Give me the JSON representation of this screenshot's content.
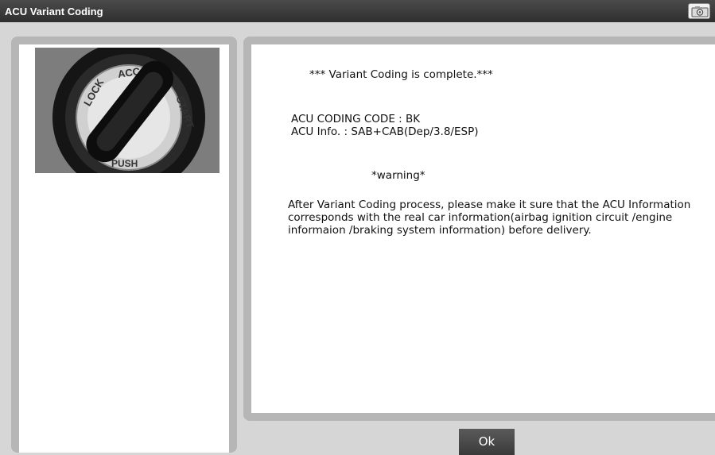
{
  "window": {
    "title": "ACU Variant Coding",
    "icons": {
      "capture": "camera-icon",
      "image": "ignition-key-image"
    }
  },
  "message": {
    "complete": "*** Variant Coding is complete.***",
    "coding_code": "ACU CODING CODE :  BK",
    "acu_info": "ACU Info. : SAB+CAB(Dep/3.8/ESP)",
    "warning_title": "*warning*",
    "warning_text": "After Variant Coding process, please make it sure that the ACU Information corresponds with the real car information(airbag ignition circuit /engine informaion /braking system information) before delivery."
  },
  "buttons": {
    "ok": "Ok"
  },
  "key_labels": {
    "lock": "LOCK",
    "acc": "ACC",
    "start": "START",
    "push": "PUSH"
  }
}
